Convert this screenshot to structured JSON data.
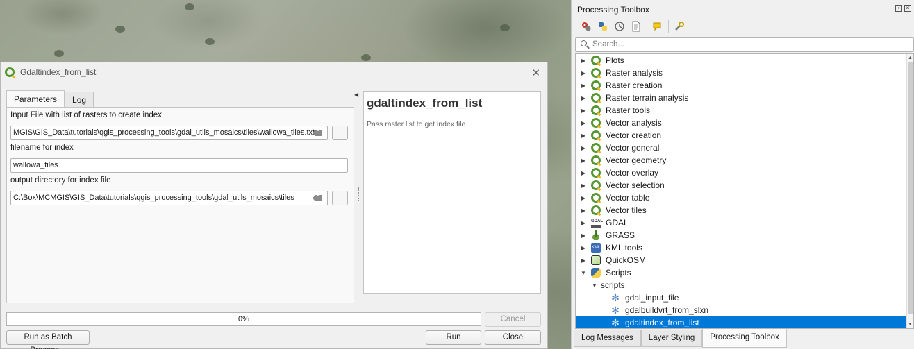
{
  "dialog": {
    "title": "Gdaltindex_from_list",
    "close_symbol": "✕",
    "tabs": [
      "Parameters",
      "Log"
    ],
    "params": [
      {
        "label": "Input File with list of rasters to create index",
        "value": "MGIS\\GIS_Data\\tutorials\\qgis_processing_tools\\gdal_utils_mosaics\\tiles\\wallowa_tiles.txt"
      },
      {
        "label": "filename for index",
        "value": "wallowa_tiles"
      },
      {
        "label": "output directory for index file",
        "value": "C:\\Box\\MCMGIS\\GIS_Data\\tutorials\\qgis_processing_tools\\gdal_utils_mosaics\\tiles"
      }
    ],
    "browse_label": "...",
    "help": {
      "title": "gdaltindex_from_list",
      "description": "Pass raster list to get index file"
    },
    "progress": {
      "value": 0,
      "label": "0%"
    },
    "buttons": {
      "cancel": "Cancel",
      "batch": "Run as Batch Process...",
      "run": "Run",
      "close": "Close"
    }
  },
  "toolbox": {
    "title": "Processing Toolbox",
    "search_placeholder": "Search...",
    "tree": [
      {
        "label": "Plots",
        "icon": "qgis-icon",
        "expanded": false
      },
      {
        "label": "Raster analysis",
        "icon": "qgis-icon",
        "expanded": false
      },
      {
        "label": "Raster creation",
        "icon": "qgis-icon",
        "expanded": false
      },
      {
        "label": "Raster terrain analysis",
        "icon": "qgis-icon",
        "expanded": false
      },
      {
        "label": "Raster tools",
        "icon": "qgis-icon",
        "expanded": false
      },
      {
        "label": "Vector analysis",
        "icon": "qgis-icon",
        "expanded": false
      },
      {
        "label": "Vector creation",
        "icon": "qgis-icon",
        "expanded": false
      },
      {
        "label": "Vector general",
        "icon": "qgis-icon",
        "expanded": false
      },
      {
        "label": "Vector geometry",
        "icon": "qgis-icon",
        "expanded": false
      },
      {
        "label": "Vector overlay",
        "icon": "qgis-icon",
        "expanded": false
      },
      {
        "label": "Vector selection",
        "icon": "qgis-icon",
        "expanded": false
      },
      {
        "label": "Vector table",
        "icon": "qgis-icon",
        "expanded": false
      },
      {
        "label": "Vector tiles",
        "icon": "qgis-icon",
        "expanded": false
      },
      {
        "label": "GDAL",
        "icon": "gdal-icon",
        "expanded": false
      },
      {
        "label": "GRASS",
        "icon": "grass-icon",
        "expanded": false
      },
      {
        "label": "KML tools",
        "icon": "kml-icon",
        "expanded": false
      },
      {
        "label": "QuickOSM",
        "icon": "quickosm-icon",
        "expanded": false
      },
      {
        "label": "Scripts",
        "icon": "python-icon",
        "expanded": true
      },
      {
        "label": "scripts",
        "icon": "none",
        "expanded": true,
        "level": 1
      },
      {
        "label": "gdal_input_file",
        "icon": "script-gear-icon",
        "level": 2
      },
      {
        "label": "gdalbuildvrt_from_slxn",
        "icon": "script-gear-icon",
        "level": 2
      },
      {
        "label": "gdaltindex_from_list",
        "icon": "script-gear-icon",
        "level": 2,
        "selected": true
      }
    ]
  },
  "bottom_tabs": [
    "Log Messages",
    "Layer Styling",
    "Processing Toolbox"
  ],
  "colors": {
    "selection": "#0078d7",
    "qgis_green": "#589632",
    "qgis_yellow": "#f0b318"
  }
}
